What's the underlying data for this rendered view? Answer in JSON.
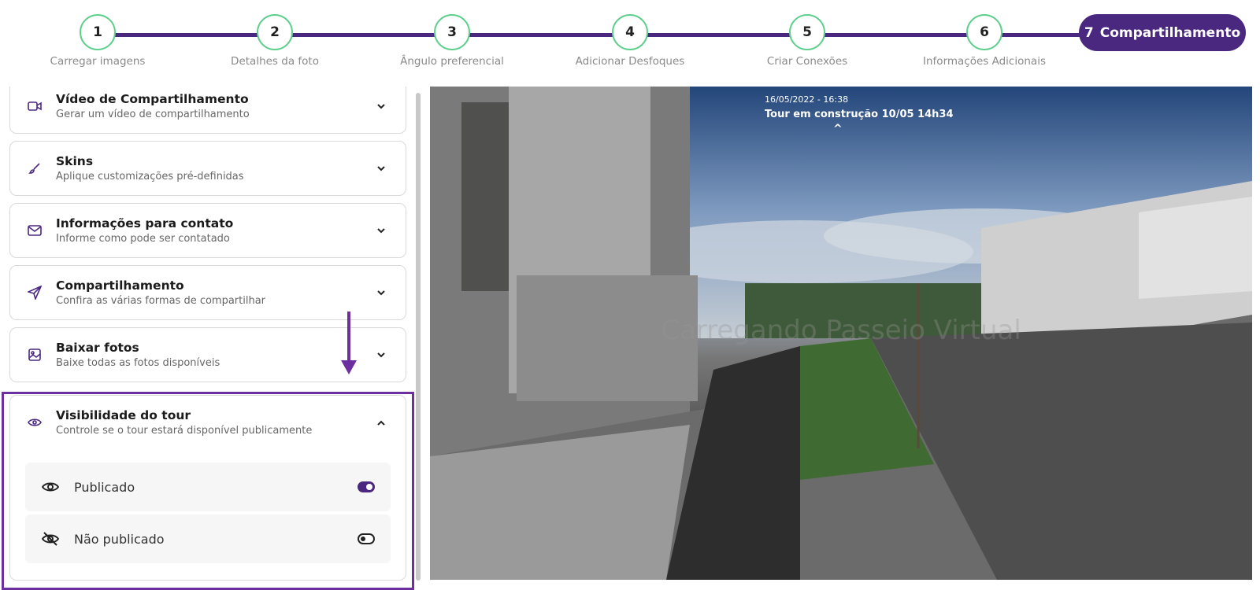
{
  "stepper": {
    "steps": [
      {
        "num": "1",
        "label": "Carregar imagens"
      },
      {
        "num": "2",
        "label": "Detalhes da foto"
      },
      {
        "num": "3",
        "label": "Ângulo preferencial"
      },
      {
        "num": "4",
        "label": "Adicionar Desfoques"
      },
      {
        "num": "5",
        "label": "Criar Conexões"
      },
      {
        "num": "6",
        "label": "Informações Adicionais"
      }
    ],
    "active": {
      "num": "7",
      "label": "Compartilhamento"
    },
    "colors": {
      "track": "#4a2880",
      "done_border": "#5fcf8c",
      "active_bg": "#4a2880"
    }
  },
  "sidebar": {
    "panels": [
      {
        "title": "Vídeo de Compartilhamento",
        "subtitle": "Gerar um vídeo de compartilhamento",
        "icon": "video-camera-icon",
        "expanded": false
      },
      {
        "title": "Skins",
        "subtitle": "Aplique customizações pré-definidas",
        "icon": "brush-icon",
        "expanded": false
      },
      {
        "title": "Informações para contato",
        "subtitle": "Informe como pode ser contatado",
        "icon": "envelope-icon",
        "expanded": false
      },
      {
        "title": "Compartilhamento",
        "subtitle": "Confira as várias formas de compartilhar",
        "icon": "paper-plane-icon",
        "expanded": false
      },
      {
        "title": "Baixar fotos",
        "subtitle": "Baixe todas as fotos disponíveis",
        "icon": "image-icon",
        "expanded": false
      },
      {
        "title": "Visibilidade do tour",
        "subtitle": "Controle se o tour estará disponível publicamente",
        "icon": "eye-icon",
        "expanded": true
      }
    ],
    "visibility_options": [
      {
        "label": "Publicado",
        "icon": "eye-icon",
        "selected": true
      },
      {
        "label": "Não publicado",
        "icon": "eye-off-icon",
        "selected": false
      }
    ],
    "highlight_color": "#6b2f9f"
  },
  "viewer": {
    "date": "16/05/2022 - 16:38",
    "title": "Tour em construção 10/05 14h34",
    "loading_text": "Carregando Passeio Virtual"
  }
}
